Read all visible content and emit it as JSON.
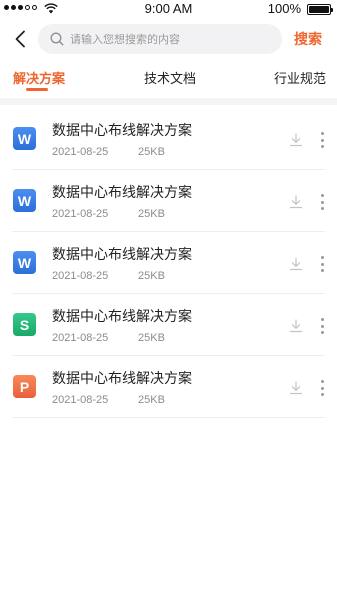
{
  "status_bar": {
    "time": "9:00 AM",
    "battery": "100%",
    "battery_level": 1.0
  },
  "search": {
    "placeholder": "请输入您想搜索的内容",
    "value": "",
    "button_label": "搜索",
    "icons": {
      "back": "chevron-left-icon",
      "search": "search-icon"
    }
  },
  "tabs": [
    {
      "label": "解决方案",
      "active": true
    },
    {
      "label": "技术文档",
      "active": false
    },
    {
      "label": "行业规范",
      "active": false
    }
  ],
  "documents": [
    {
      "title": "数据中心布线解决方案",
      "date": "2021-08-25",
      "size": "25KB",
      "type": "word",
      "icon_letter": "W"
    },
    {
      "title": "数据中心布线解决方案",
      "date": "2021-08-25",
      "size": "25KB",
      "type": "word",
      "icon_letter": "W"
    },
    {
      "title": "数据中心布线解决方案",
      "date": "2021-08-25",
      "size": "25KB",
      "type": "word",
      "icon_letter": "W"
    },
    {
      "title": "数据中心布线解决方案",
      "date": "2021-08-25",
      "size": "25KB",
      "type": "excel",
      "icon_letter": "S"
    },
    {
      "title": "数据中心布线解决方案",
      "date": "2021-08-25",
      "size": "25KB",
      "type": "ppt",
      "icon_letter": "P"
    }
  ],
  "colors": {
    "accent": "#f0652f",
    "word": "#2c6fd8",
    "excel": "#19a86a",
    "ppt": "#e8603a"
  }
}
